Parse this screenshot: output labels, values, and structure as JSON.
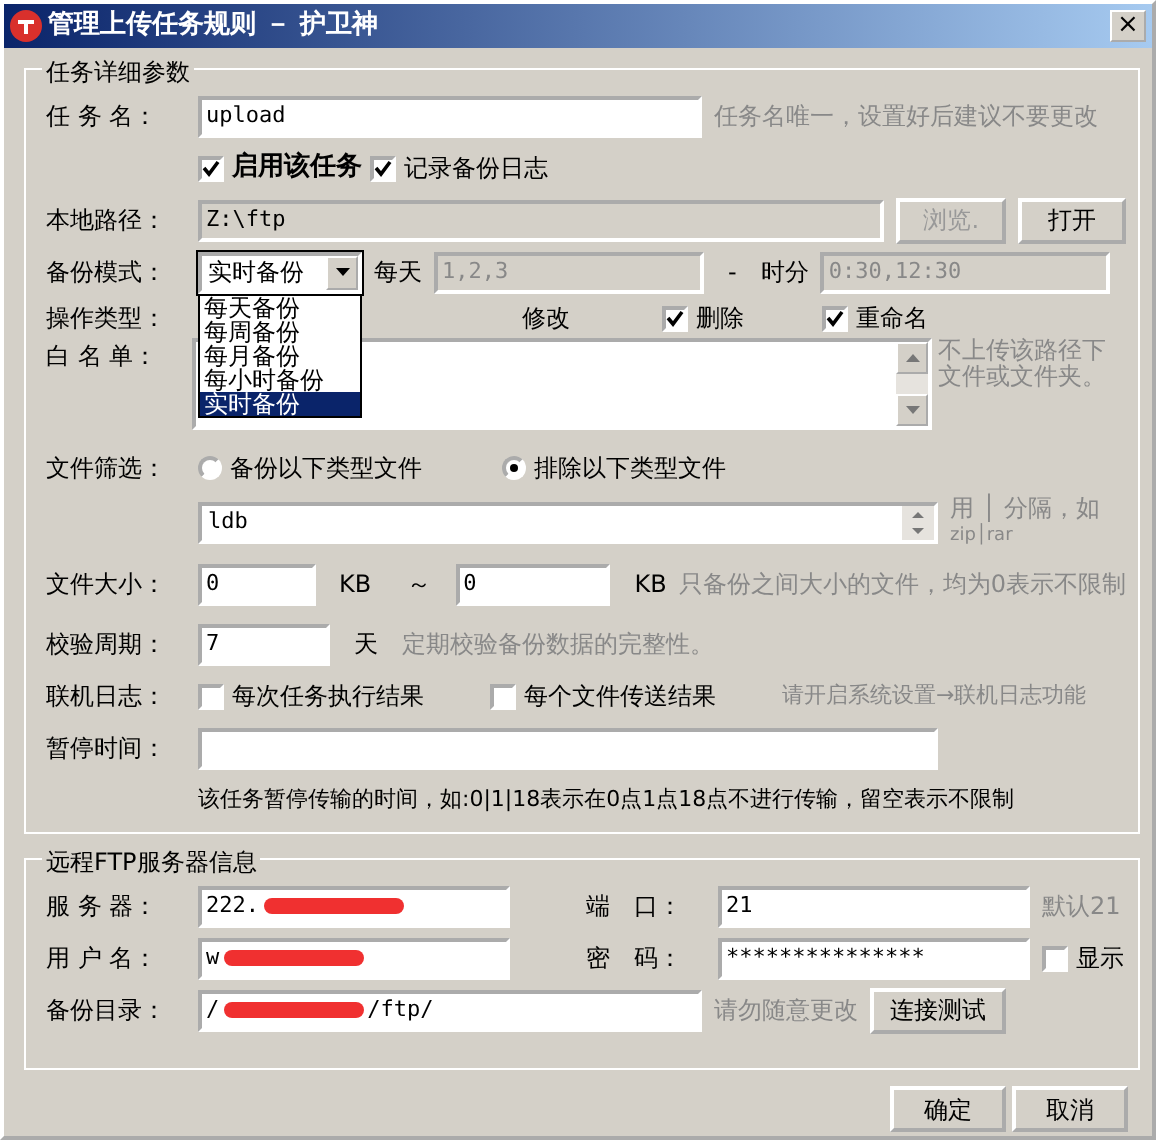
{
  "window": {
    "title": "管理上传任务规则 － 护卫神",
    "close": "×"
  },
  "details": {
    "legend": "任务详细参数",
    "task_name": {
      "label": "任 务 名：",
      "value": "upload",
      "hint": "任务名唯一，设置好后建议不要更改"
    },
    "options": [
      {
        "label": "启用该任务",
        "checked": true,
        "bold": true
      },
      {
        "label": "记录备份日志",
        "checked": true,
        "bold": false
      }
    ],
    "local_path": {
      "label": "本地路径：",
      "value": "Z:\\ftp",
      "buttons": [
        {
          "label": "浏览.",
          "disabled": true
        },
        {
          "label": "打开",
          "disabled": false
        }
      ]
    },
    "mode": {
      "label": "备份模式：",
      "value": "实时备份",
      "expanded": true,
      "options": [
        {
          "label": "每天备份",
          "selected": false
        },
        {
          "label": "每周备份",
          "selected": false
        },
        {
          "label": "每月备份",
          "selected": false
        },
        {
          "label": "每小时备份",
          "selected": false
        },
        {
          "label": "实时备份",
          "selected": true
        }
      ],
      "days_label": "每天",
      "days_value": "1,2,3",
      "dash": "-",
      "time_label": "时分",
      "time_value": "0:30,12:30"
    },
    "op_types": {
      "label": "操作类型：",
      "items": [
        {
          "label": "修改"
        },
        {
          "label": "删除",
          "checked": true
        },
        {
          "label": "重命名",
          "checked": true
        }
      ]
    },
    "whitelist": {
      "label": "白 名 单：",
      "hint": "不上传该路径下文件或文件夹。"
    },
    "filter": {
      "label": "文件筛选：",
      "radios": [
        {
          "label": "备份以下类型文件",
          "selected": false
        },
        {
          "label": "排除以下类型文件",
          "selected": true
        }
      ],
      "value": "ldb",
      "hint_top": "用 │ 分隔，如",
      "hint_bottom": "zip│rar"
    },
    "size": {
      "label": "文件大小：",
      "min": "0",
      "unit1": "KB",
      "tilde": "～",
      "max": "0",
      "unit2": "KB",
      "hint": "只备份之间大小的文件，均为0表示不限制"
    },
    "verify": {
      "label": "校验周期：",
      "value": "7",
      "unit": "天",
      "hint": "定期校验备份数据的完整性。"
    },
    "online_log": {
      "label": "联机日志：",
      "items": [
        {
          "label": "每次任务执行结果",
          "checked": false
        },
        {
          "label": "每个文件传送结果",
          "checked": false
        }
      ],
      "hint": "请开启系统设置→联机日志功能"
    },
    "pause": {
      "label": "暂停时间：",
      "hint": "该任务暂停传输的时间，如:0|1|18表示在0点1点18点不进行传输，留空表示不限制"
    }
  },
  "ftp": {
    "legend": "远程FTP服务器信息",
    "server": {
      "label": "服 务 器：",
      "value_start": "222.",
      "redacted": true
    },
    "port": {
      "label": "端　口：",
      "value": "21",
      "hint": "默认21"
    },
    "user": {
      "label": "用 户 名：",
      "value_start": "w",
      "redacted": true
    },
    "password": {
      "label": "密　码：",
      "value": "***************",
      "show_label": "显示",
      "show_checked": false
    },
    "dir": {
      "label": "备份目录：",
      "value_start": "/",
      "value_end": "/ftp/",
      "redacted": true,
      "hint": "请勿随意更改",
      "test_button": "连接测试"
    }
  },
  "buttons": [
    "确定",
    "取消"
  ]
}
